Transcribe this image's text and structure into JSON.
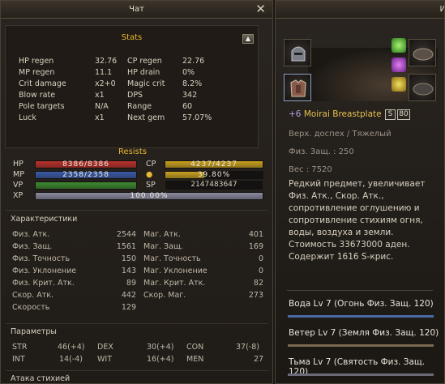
{
  "left_window": {
    "title": "Чат",
    "stats_header": "Stats",
    "stats": [
      {
        "l1": "HP regen",
        "v1": "32.76",
        "l2": "CP regen",
        "v2": "22.76"
      },
      {
        "l1": "MP regen",
        "v1": "11.1",
        "l2": "HP drain",
        "v2": "0%"
      },
      {
        "l1": "Crit damage",
        "v1": "x2+0",
        "l2": "Magic crit",
        "v2": "8.2%"
      },
      {
        "l1": "Blow rate",
        "v1": "x1",
        "l2": "DPS",
        "v2": "342"
      },
      {
        "l1": "Pole targets",
        "v1": "N/A",
        "l2": "Range",
        "v2": "60"
      },
      {
        "l1": "Luck",
        "v1": "x1",
        "l2": "Next gem",
        "v2": "57.07%"
      }
    ],
    "resists_header": "Resists",
    "bars": {
      "hp": {
        "label": "HP",
        "text": "8386/8386",
        "fraction": 1.0,
        "color": "#b8322c"
      },
      "mp": {
        "label": "MP",
        "text": "2358/2358",
        "fraction": 1.0,
        "color": "#3a5aa8"
      },
      "vp": {
        "label": "VP",
        "fraction": 1.0,
        "color": "#3c8a30"
      },
      "xp": {
        "label": "XP",
        "text": "100.00%",
        "fraction": 1.0,
        "color": "#8a8aa0"
      },
      "cp": {
        "label": "CP",
        "text": "4237/4237",
        "fraction": 1.0,
        "color": "#c8a020"
      },
      "gem": {
        "text": "39.80%",
        "fraction": 0.398,
        "color": "#c8a020"
      },
      "sp": {
        "label": "SP",
        "text": "2147483647"
      }
    },
    "characteristics_header": "Характеристики",
    "characteristics": [
      {
        "l1": "Физ. Атк.",
        "v1": "2544",
        "l2": "Маг. Атк.",
        "v2": "401"
      },
      {
        "l1": "Физ. Защ.",
        "v1": "1561",
        "l2": "Маг. Защ.",
        "v2": "169"
      },
      {
        "l1": "Физ. Точность",
        "v1": "150",
        "l2": "Маг. Точность",
        "v2": "0"
      },
      {
        "l1": "Физ. Уклонение",
        "v1": "143",
        "l2": "Маг. Уклонение",
        "v2": "0"
      },
      {
        "l1": "Физ. Крит. Атк.",
        "v1": "89",
        "l2": "Маг. Крит. Атк.",
        "v2": "82"
      },
      {
        "l1": "Скор. Атк.",
        "v1": "442",
        "l2": "Скор. Маг.",
        "v2": "273"
      },
      {
        "l1": "Скорость",
        "v1": "129",
        "l2": "",
        "v2": ""
      }
    ],
    "parameters_header": "Параметры",
    "parameters": [
      {
        "a": "STR",
        "av": "46(+4)",
        "b": "DEX",
        "bv": "30(+4)",
        "c": "CON",
        "cv": "37(-8)"
      },
      {
        "a": "INT",
        "av": "14(-4)",
        "b": "WIT",
        "bv": "16(+4)",
        "c": "MEN",
        "cv": "27"
      }
    ],
    "elements_header": "Атака стихией"
  },
  "right_window": {
    "title": "И",
    "item": {
      "enchant": "+6",
      "name": "Moirai Breastplate",
      "grade": "S",
      "grade_level": "80",
      "type": "Верх. доспех / Тяжелый",
      "pdef": "Физ. Защ. : 250",
      "weight": "Вес : 7520",
      "description": "Редкий предмет, увеличивает Физ. Атк., Скор. Атк., сопротивление оглушению и сопротивление стихиям огня, воды, воздуха и земли.",
      "price": "Стоимость 33673000 аден.",
      "crystals": "Содержит 1616 S-крис."
    },
    "attributes": [
      {
        "text": "Вода Lv 7 (Огонь Физ. Защ. 120)",
        "color": "#4a6aa8"
      },
      {
        "text": "Ветер Lv 7 (Земля Физ. Защ. 120)",
        "color": "#7a6a50"
      },
      {
        "text": "Тьма Lv 7 (Святость Физ. Защ. 120)",
        "color": "#6a6a78"
      }
    ],
    "colors": {
      "accent": "#e8b830",
      "item_name": "#e8c050",
      "enchant": "#b7a0e8"
    }
  }
}
